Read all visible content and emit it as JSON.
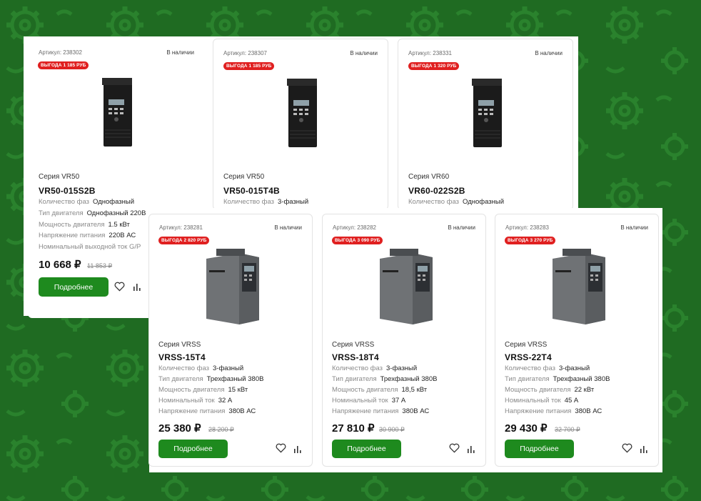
{
  "colors": {
    "accent": "#1e8a1e",
    "badge": "#e02020",
    "background": "#1f6b22"
  },
  "cards": [
    {
      "sku": "Артикул: 238302",
      "stock": "В наличии",
      "badge": "ВЫГОДА 1 185 РУБ",
      "series": "Серия VR50",
      "model": "VR50-015S2B",
      "image_icon": "inverter-small-icon",
      "specs": [
        {
          "k": "Количество фаз",
          "v": "Однофазный"
        },
        {
          "k": "Тип двигателя",
          "v": "Однофазный 220В"
        },
        {
          "k": "Мощность двигателя",
          "v": "1.5 кВт"
        },
        {
          "k": "Напряжение питания",
          "v": "220В АС"
        },
        {
          "k": "Номинальный выходной ток G/P",
          "v": ""
        }
      ],
      "price": "10 668 ₽",
      "old_price": "11 853 ₽",
      "button": "Подробнее"
    },
    {
      "sku": "Артикул: 238307",
      "stock": "В наличии",
      "badge": "ВЫГОДА 1 185 РУБ",
      "series": "Серия VR50",
      "model": "VR50-015T4B",
      "image_icon": "inverter-small-icon",
      "specs": [
        {
          "k": "Количество фаз",
          "v": "3-фазный"
        }
      ]
    },
    {
      "sku": "Артикул: 238331",
      "stock": "В наличии",
      "badge": "ВЫГОДА 1 320 РУБ",
      "series": "Серия VR60",
      "model": "VR60-022S2B",
      "image_icon": "inverter-small-icon",
      "specs": [
        {
          "k": "Количество фаз",
          "v": "Однофазный"
        }
      ]
    },
    {
      "sku": "Артикул: 238281",
      "stock": "В наличии",
      "badge": "ВЫГОДА 2 820 РУБ",
      "series": "Серия VRSS",
      "model": "VRSS-15T4",
      "image_icon": "inverter-large-icon",
      "specs": [
        {
          "k": "Количество фаз",
          "v": "3-фазный"
        },
        {
          "k": "Тип двигателя",
          "v": "Трехфазный 380В"
        },
        {
          "k": "Мощность двигателя",
          "v": "15 кВт"
        },
        {
          "k": "Номинальный ток",
          "v": "32 А"
        },
        {
          "k": "Напряжение питания",
          "v": "380В АС"
        }
      ],
      "price": "25 380 ₽",
      "old_price": "28 200 ₽",
      "button": "Подробнее"
    },
    {
      "sku": "Артикул: 238282",
      "stock": "В наличии",
      "badge": "ВЫГОДА 3 090 РУБ",
      "series": "Серия VRSS",
      "model": "VRSS-18T4",
      "image_icon": "inverter-large-icon",
      "specs": [
        {
          "k": "Количество фаз",
          "v": "3-фазный"
        },
        {
          "k": "Тип двигателя",
          "v": "Трехфазный 380В"
        },
        {
          "k": "Мощность двигателя",
          "v": "18,5 кВт"
        },
        {
          "k": "Номинальный ток",
          "v": "37 А"
        },
        {
          "k": "Напряжение питания",
          "v": "380В АС"
        }
      ],
      "price": "27 810 ₽",
      "old_price": "30 900 ₽",
      "button": "Подробнее"
    },
    {
      "sku": "Артикул: 238283",
      "stock": "В наличии",
      "badge": "ВЫГОДА 3 270 РУБ",
      "series": "Серия VRSS",
      "model": "VRSS-22T4",
      "image_icon": "inverter-large-icon",
      "specs": [
        {
          "k": "Количество фаз",
          "v": "3-фазный"
        },
        {
          "k": "Тип двигателя",
          "v": "Трехфазный 380В"
        },
        {
          "k": "Мощность двигателя",
          "v": "22 кВт"
        },
        {
          "k": "Номинальный ток",
          "v": "45 А"
        },
        {
          "k": "Напряжение питания",
          "v": "380В АС"
        }
      ],
      "price": "29 430 ₽",
      "old_price": "32 700 ₽",
      "button": "Подробнее"
    }
  ]
}
